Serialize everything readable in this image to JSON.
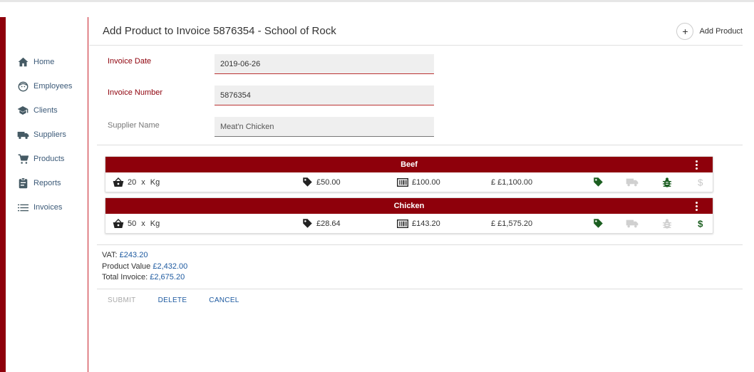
{
  "colors": {
    "brand": "#8e000b",
    "green": "#1b5e20",
    "link": "#1e5aa0"
  },
  "sidebar": {
    "items": [
      {
        "label": "Home",
        "icon": "home-icon"
      },
      {
        "label": "Employees",
        "icon": "face-icon"
      },
      {
        "label": "Clients",
        "icon": "school-icon"
      },
      {
        "label": "Suppliers",
        "icon": "truck-icon"
      },
      {
        "label": "Products",
        "icon": "cart-icon"
      },
      {
        "label": "Reports",
        "icon": "clipboard-icon"
      },
      {
        "label": "Invoices",
        "icon": "list-icon"
      }
    ]
  },
  "header": {
    "title": "Add Product to Invoice 5876354 - School of Rock",
    "add_label": "Add Product",
    "add_symbol": "+"
  },
  "form": {
    "date": {
      "label": "Invoice Date",
      "value": "2019-06-26"
    },
    "number": {
      "label": "Invoice Number",
      "value": "5876354"
    },
    "supplier": {
      "label": "Supplier Name",
      "value": "Meat'n Chicken"
    }
  },
  "products": [
    {
      "name": "Beef",
      "quantity": "20",
      "x": "x",
      "unit": "Kg",
      "price": "£50.00",
      "value": "£100.00",
      "total": "£ £1,100.00",
      "status": {
        "tag": "active",
        "truck": "inactive",
        "bug": "active",
        "dollar": "inactive"
      }
    },
    {
      "name": "Chicken",
      "quantity": "50",
      "x": "x",
      "unit": "Kg",
      "price": "£28.64",
      "value": "£143.20",
      "total": "£ £1,575.20",
      "status": {
        "tag": "active",
        "truck": "inactive",
        "bug": "inactive",
        "dollar": "active"
      }
    }
  ],
  "totals": {
    "vat_label": "VAT:",
    "vat": "£243.20",
    "product_label": "Product Value",
    "product": "£2,432.00",
    "total_label": "Total Invoice:",
    "total": "£2,675.20"
  },
  "actions": {
    "submit": "SUBMIT",
    "delete": "DELETE",
    "cancel": "CANCEL"
  }
}
